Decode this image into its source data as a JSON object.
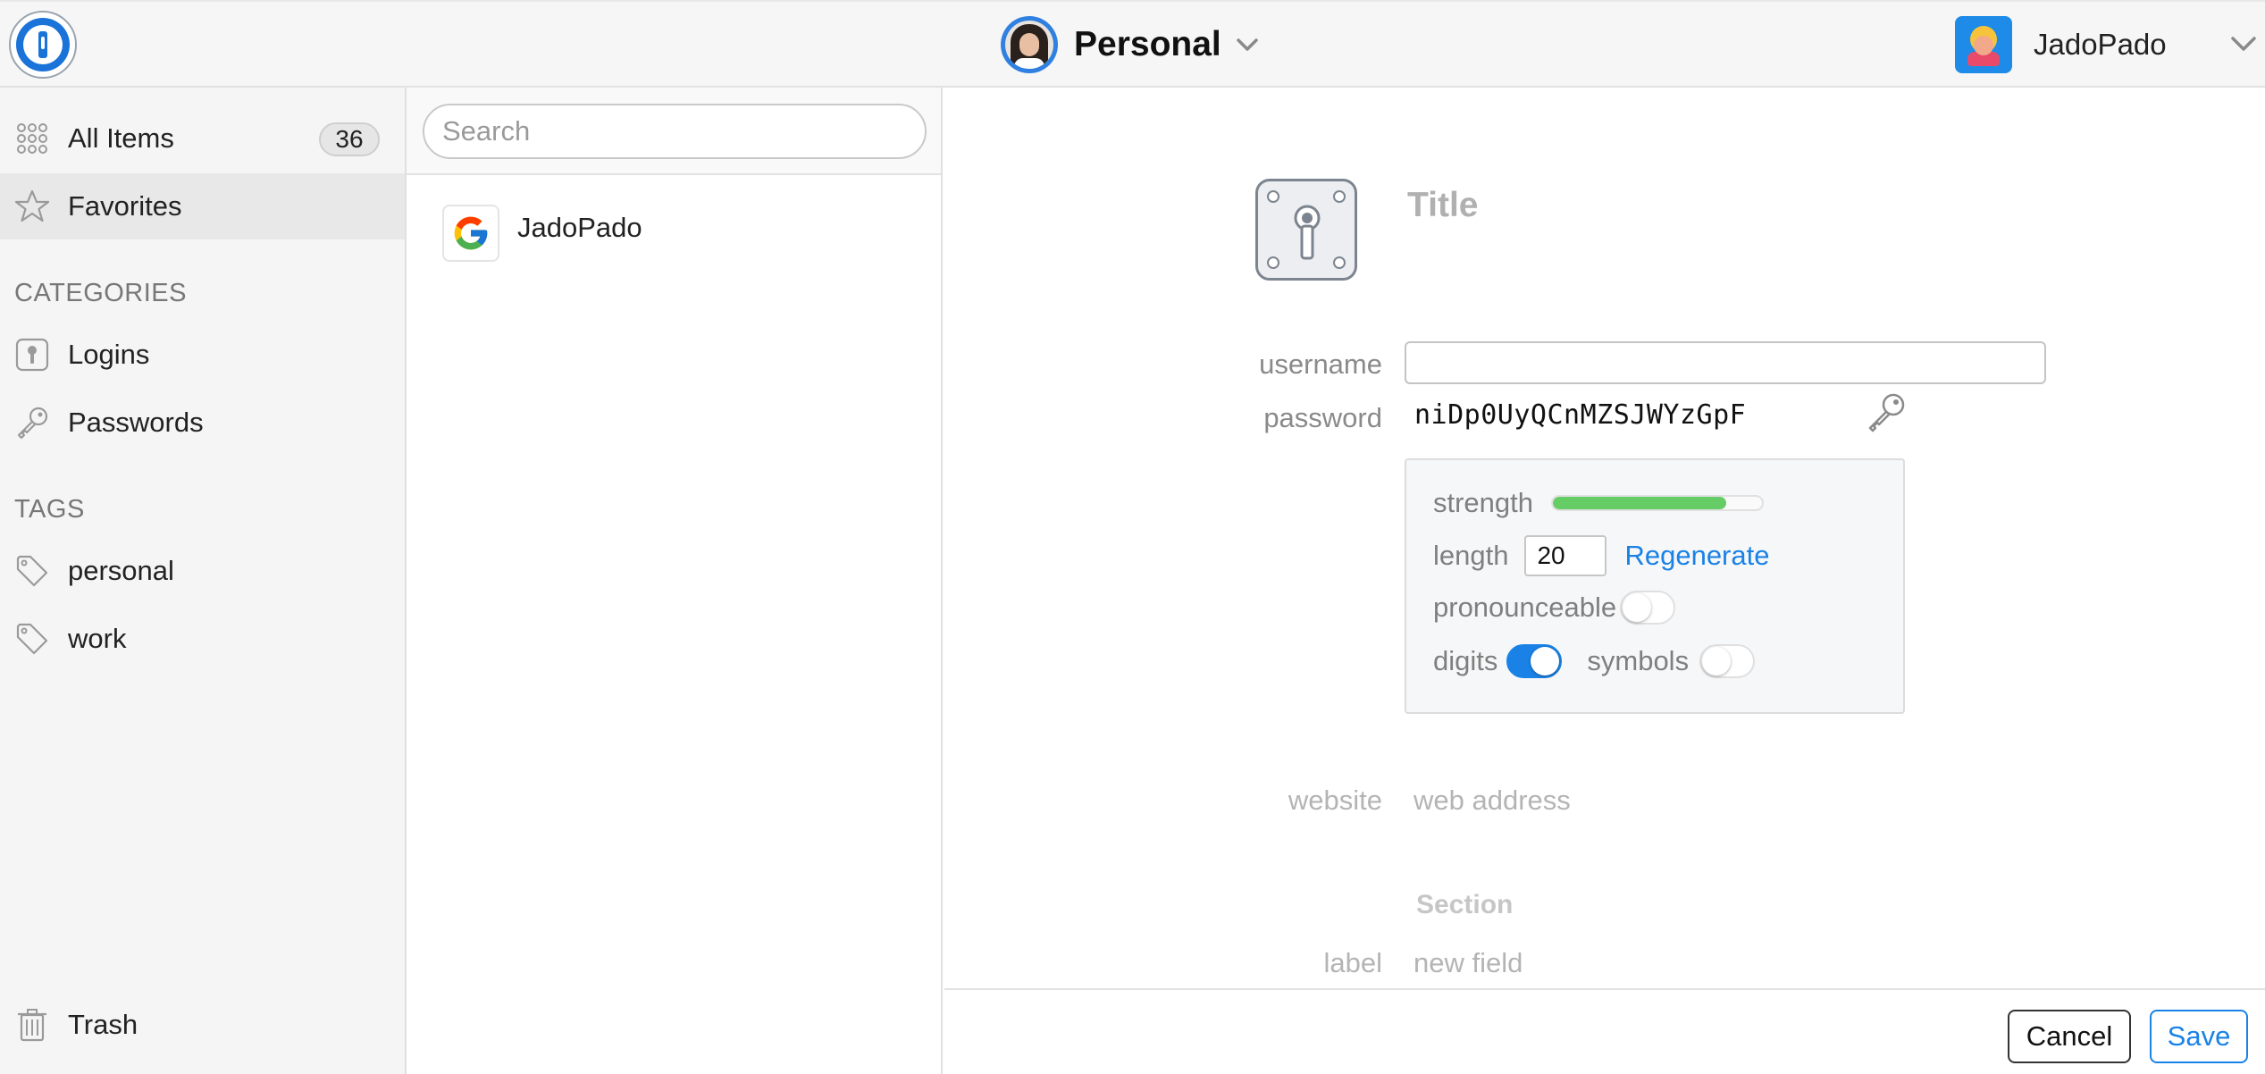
{
  "topbar": {
    "vault_name": "Personal",
    "account_name": "JadoPado"
  },
  "sidebar": {
    "all_items_label": "All Items",
    "all_items_count": "36",
    "favorites_label": "Favorites",
    "categories_heading": "CATEGORIES",
    "categories": [
      {
        "label": "Logins",
        "icon": "login-icon"
      },
      {
        "label": "Passwords",
        "icon": "key-icon"
      }
    ],
    "tags_heading": "TAGS",
    "tags": [
      {
        "label": "personal",
        "icon": "tag-icon"
      },
      {
        "label": "work",
        "icon": "tag-icon"
      }
    ],
    "trash_label": "Trash"
  },
  "list": {
    "search_placeholder": "Search",
    "items": [
      {
        "title": "JadoPado",
        "icon": "google-icon"
      }
    ]
  },
  "editor": {
    "title_placeholder": "Title",
    "username_label": "username",
    "username_value": "",
    "password_label": "password",
    "password_value": "niDp0UyQCnMZSJWYzGpF",
    "generator": {
      "strength_label": "strength",
      "strength_fraction": 0.83,
      "length_label": "length",
      "length_value": "20",
      "regenerate_label": "Regenerate",
      "pronounceable_label": "pronounceable",
      "pronounceable_on": false,
      "digits_label": "digits",
      "digits_on": true,
      "symbols_label": "symbols",
      "symbols_on": false
    },
    "website_label": "website",
    "website_placeholder": "web address",
    "section_label": "Section",
    "field_label": "label",
    "field_placeholder": "new field"
  },
  "footer": {
    "cancel_label": "Cancel",
    "save_label": "Save"
  },
  "colors": {
    "accent": "#1a82e6",
    "strength": "#66cc66",
    "sidebar_bg": "#f5f5f5"
  }
}
